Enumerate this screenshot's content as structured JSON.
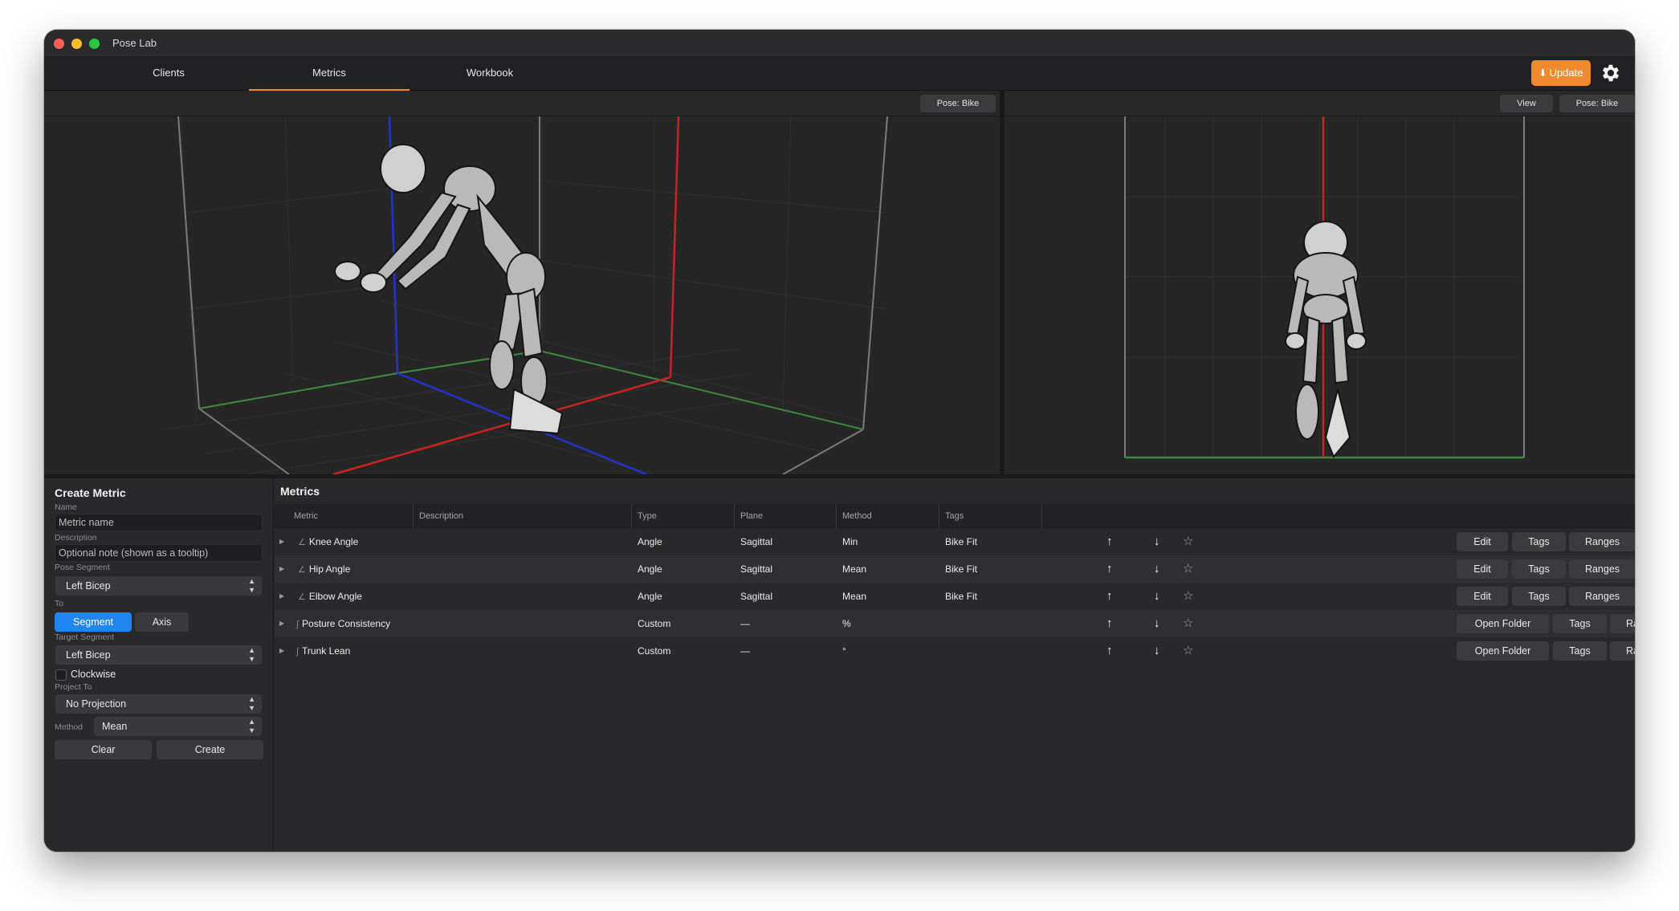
{
  "app": {
    "title": "Pose Lab"
  },
  "tabs": [
    {
      "label": "Clients"
    },
    {
      "label": "Metrics"
    },
    {
      "label": "Workbook"
    }
  ],
  "toolbar": {
    "update_label": "Update",
    "accent": "#ef8a2f"
  },
  "viewports": {
    "left": {
      "pose_label": "Pose: Bike"
    },
    "right": {
      "view_label": "View",
      "pose_label": "Pose: Bike"
    }
  },
  "create_metric": {
    "title": "Create Metric",
    "name_label": "Name",
    "name_placeholder": "Metric name",
    "description_label": "Description",
    "description_placeholder": "Optional note (shown as a tooltip)",
    "pose_segment_label": "Pose Segment",
    "pose_segment_value": "Left Bicep",
    "to_label": "To",
    "to_options": [
      "Segment",
      "Axis"
    ],
    "to_selected": "Segment",
    "target_segment_label": "Target Segment",
    "target_segment_value": "Left Bicep",
    "clockwise_label": "Clockwise",
    "project_to_label": "Project To",
    "project_to_value": "No Projection",
    "method_label": "Method",
    "method_value": "Mean",
    "clear_label": "Clear",
    "create_label": "Create"
  },
  "metrics": {
    "title": "Metrics",
    "columns": [
      "Metric",
      "Description",
      "Type",
      "Plane",
      "Method",
      "Tags"
    ],
    "rows": [
      {
        "metric": "Knee Angle",
        "icon": "∠",
        "description": "",
        "type": "Angle",
        "plane": "Sagittal",
        "method": "Min",
        "tags": "Bike Fit",
        "actions": [
          "Edit",
          "Tags",
          "Ranges"
        ]
      },
      {
        "metric": "Hip Angle",
        "icon": "∠",
        "description": "",
        "type": "Angle",
        "plane": "Sagittal",
        "method": "Mean",
        "tags": "Bike Fit",
        "actions": [
          "Edit",
          "Tags",
          "Ranges"
        ]
      },
      {
        "metric": "Elbow Angle",
        "icon": "∠",
        "description": "",
        "type": "Angle",
        "plane": "Sagittal",
        "method": "Mean",
        "tags": "Bike Fit",
        "actions": [
          "Edit",
          "Tags",
          "Ranges"
        ]
      },
      {
        "metric": "Posture Consistency",
        "icon": "∫",
        "description": "",
        "type": "Custom",
        "plane": "—",
        "method": "%",
        "tags": "",
        "actions": [
          "Open Folder",
          "Tags",
          "Ranges"
        ]
      },
      {
        "metric": "Trunk Lean",
        "icon": "∫",
        "description": "",
        "type": "Custom",
        "plane": "—",
        "method": "°",
        "tags": "",
        "actions": [
          "Open Folder",
          "Tags",
          "Ranges"
        ]
      }
    ]
  }
}
